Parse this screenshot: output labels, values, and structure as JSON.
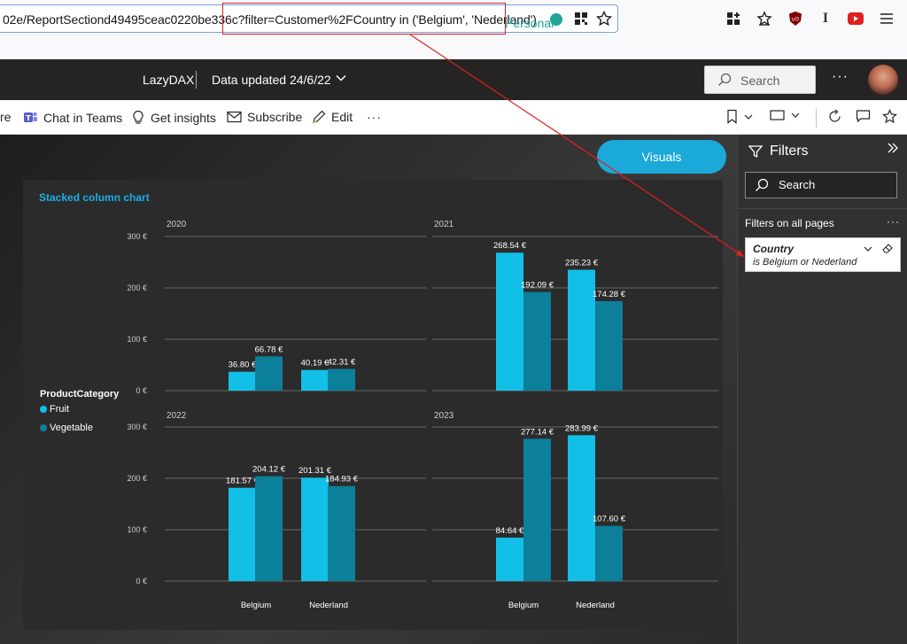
{
  "browser": {
    "url_prefix": "02e/ReportSectiond49495ceac0220be336c?",
    "url_filter": "filter=Customer%2FCountry in ('Belgium', 'Nederland')",
    "container_label": "Personal",
    "icons": [
      "page-grid-icon",
      "star-icon",
      "extensions-icon",
      "reading-list-icon",
      "ublock-icon",
      "ibeam-icon",
      "youtube-icon",
      "menu-icon"
    ]
  },
  "header": {
    "app_title": "LazyDAX",
    "data_updated": "Data updated 24/6/22",
    "search_label": "Search",
    "more_label": "···"
  },
  "actions": {
    "share_partial": "re",
    "chat_in_teams": "Chat in Teams",
    "get_insights": "Get insights",
    "subscribe": "Subscribe",
    "edit": "Edit",
    "more": "···"
  },
  "visuals_button": "Visuals",
  "chart": {
    "title": "Stacked column chart",
    "legend_title": "ProductCategory",
    "legend": [
      {
        "label": "Fruit",
        "color": "#12bfe6"
      },
      {
        "label": "Vegetable",
        "color": "#0c7f9a"
      }
    ]
  },
  "chart_data": {
    "type": "bar",
    "title": "Stacked column chart",
    "categories": [
      "Belgium",
      "Nederland"
    ],
    "ylim": [
      0,
      300
    ],
    "yticks": [
      "0 €",
      "100 €",
      "200 €",
      "300 €"
    ],
    "legend_title": "ProductCategory",
    "panels": [
      {
        "year": "2020",
        "series": [
          {
            "name": "Fruit",
            "values": [
              36.8,
              40.19
            ],
            "labels": [
              "36.80 €",
              "40.19 €"
            ]
          },
          {
            "name": "Vegetable",
            "values": [
              66.78,
              42.31
            ],
            "labels": [
              "66.78 €",
              "42.31 €"
            ]
          }
        ]
      },
      {
        "year": "2021",
        "series": [
          {
            "name": "Fruit",
            "values": [
              268.54,
              235.23
            ],
            "labels": [
              "268.54 €",
              "235.23 €"
            ]
          },
          {
            "name": "Vegetable",
            "values": [
              192.09,
              174.28
            ],
            "labels": [
              "192.09 €",
              "174.28 €"
            ]
          }
        ]
      },
      {
        "year": "2022",
        "series": [
          {
            "name": "Fruit",
            "values": [
              181.57,
              201.31
            ],
            "labels": [
              "181.57 €",
              "201.31 €"
            ]
          },
          {
            "name": "Vegetable",
            "values": [
              204.12,
              184.93
            ],
            "labels": [
              "204.12 €",
              "184.93 €"
            ]
          }
        ]
      },
      {
        "year": "2023",
        "series": [
          {
            "name": "Fruit",
            "values": [
              84.64,
              283.99
            ],
            "labels": [
              "84.64 €",
              "283.99 €"
            ]
          },
          {
            "name": "Vegetable",
            "values": [
              277.14,
              107.6
            ],
            "labels": [
              "277.14 €",
              "107.60 €"
            ]
          }
        ]
      }
    ],
    "colors": {
      "Fruit": "#12bfe6",
      "Vegetable": "#0c7f9a"
    }
  },
  "filters": {
    "title": "Filters",
    "search_label": "Search",
    "section_label": "Filters on all pages",
    "more": "···",
    "card": {
      "name": "Country",
      "description": "is Belgium or Nederland"
    }
  },
  "colors": {
    "accent": "#1aa9d8",
    "annotation": "#e02020"
  }
}
